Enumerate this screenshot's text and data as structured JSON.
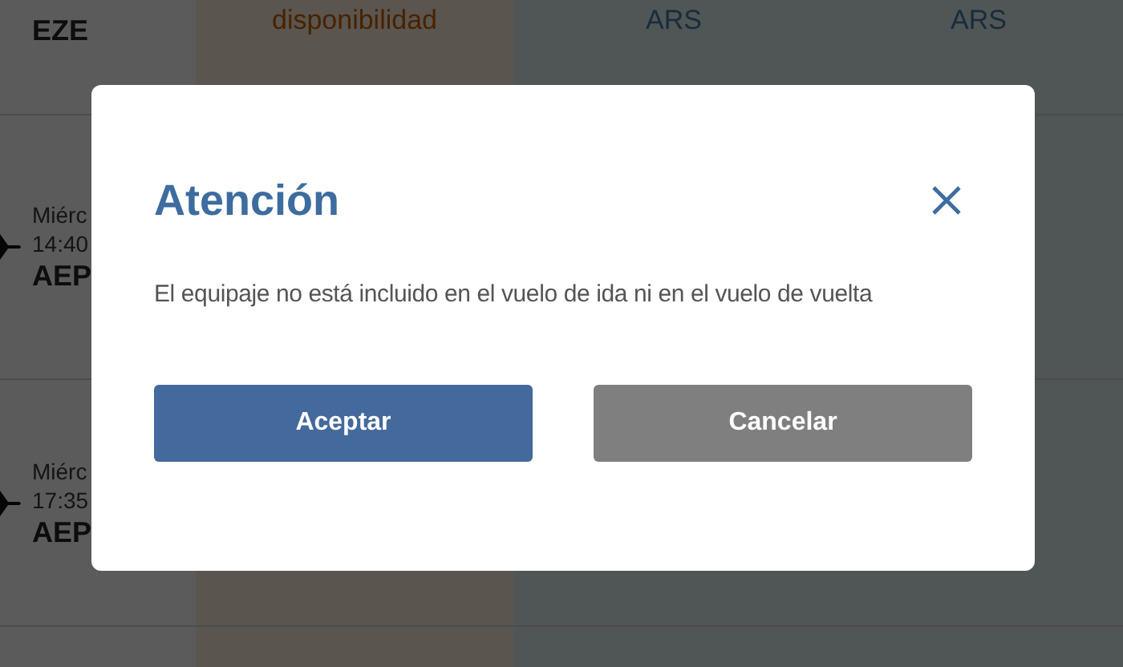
{
  "flights": [
    {
      "kind": "cut",
      "airport": "EZE",
      "availability": "disponibilidad",
      "currencies": [
        "ARS",
        "ARS"
      ]
    },
    {
      "kind": "full",
      "day": "Miérc",
      "time": "14:40",
      "airport": "AEP"
    },
    {
      "kind": "full",
      "day": "Miérc",
      "time": "17:35",
      "airport": "AEP"
    }
  ],
  "dialog": {
    "title": "Atención",
    "message": "El equipaje no está incluido en el vuelo de ida ni en el vuelo de vuelta",
    "buttons": [
      {
        "label": "Aceptar",
        "kind": "primary"
      },
      {
        "label": "Cancelar",
        "kind": "secondary"
      }
    ]
  }
}
